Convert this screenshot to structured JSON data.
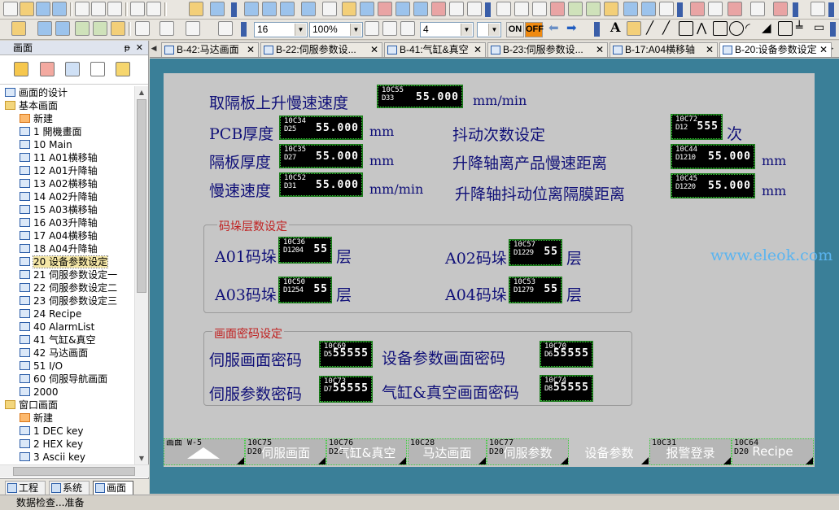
{
  "toolbar": {
    "font_size": "16",
    "zoom": "100%",
    "line_width": "4",
    "on_label": "ON",
    "off_label": "OFF",
    "letter_a": "A"
  },
  "panel": {
    "title": "画面",
    "tree": [
      {
        "label": "画面的设计",
        "kind": "root"
      },
      {
        "label": "基本画面",
        "kind": "folder"
      },
      {
        "label": "新建",
        "kind": "new"
      },
      {
        "label": "1 開機畫面",
        "kind": "page"
      },
      {
        "label": "10 Main",
        "kind": "page"
      },
      {
        "label": "11 A01横移轴",
        "kind": "page"
      },
      {
        "label": "12 A01升降轴",
        "kind": "page"
      },
      {
        "label": "13 A02横移轴",
        "kind": "page"
      },
      {
        "label": "14 A02升降轴",
        "kind": "page"
      },
      {
        "label": "15 A03横移轴",
        "kind": "page"
      },
      {
        "label": "16 A03升降轴",
        "kind": "page"
      },
      {
        "label": "17 A04横移轴",
        "kind": "page"
      },
      {
        "label": "18 A04升降轴",
        "kind": "page"
      },
      {
        "label": "20 设备参数设定",
        "kind": "page",
        "selected": true
      },
      {
        "label": "21 伺服参数设定一",
        "kind": "page"
      },
      {
        "label": "22 伺服参数设定二",
        "kind": "page"
      },
      {
        "label": "23 伺服参数设定三",
        "kind": "page"
      },
      {
        "label": "24 Recipe",
        "kind": "page"
      },
      {
        "label": "40 AlarmList",
        "kind": "page"
      },
      {
        "label": "41 气缸&真空",
        "kind": "page"
      },
      {
        "label": "42 马达画面",
        "kind": "page"
      },
      {
        "label": "51 I/O",
        "kind": "page"
      },
      {
        "label": "60 伺服导航画面",
        "kind": "page"
      },
      {
        "label": "2000",
        "kind": "page"
      },
      {
        "label": "窗口画面",
        "kind": "folder"
      },
      {
        "label": "新建",
        "kind": "new"
      },
      {
        "label": "1 DEC key",
        "kind": "page"
      },
      {
        "label": "2 HEX key",
        "kind": "page"
      },
      {
        "label": "3 Ascii key",
        "kind": "page"
      }
    ],
    "tabs": [
      "工程",
      "系统",
      "画面"
    ]
  },
  "doc_tabs": [
    {
      "label": "B-42:马达画面",
      "active": false
    },
    {
      "label": "B-22:伺服参数设...",
      "active": false
    },
    {
      "label": "B-41:气缸&真空",
      "active": false
    },
    {
      "label": "B-23:伺服参数设...",
      "active": false
    },
    {
      "label": "B-17:A04横移轴",
      "active": false
    },
    {
      "label": "B-20:设备参数设定",
      "active": true
    }
  ],
  "screen": {
    "labels": {
      "slow_up_speed": "取隔板上升慢速速度",
      "pcb_thickness": "PCB厚度",
      "spacer_thickness": "隔板厚度",
      "slow_speed": "慢速速度",
      "shake_count": "抖动次数设定",
      "lift_slow_distance": "升降轴离产品慢速距离",
      "lift_shake_distance": "升降轴抖动位离隔膜距离"
    },
    "units": {
      "mm_min_1": "mm/min",
      "mm_1": "mm",
      "mm_2": "mm",
      "mm_min_2": "mm/min",
      "times": "次",
      "mm_3": "mm",
      "mm_4": "mm"
    },
    "fields": {
      "slow_up_speed": {
        "top": "10C55",
        "bottom": "D33",
        "value": "55.000"
      },
      "pcb_thickness": {
        "top": "10C34",
        "bottom": "D25",
        "value": "55.000"
      },
      "spacer_thickness": {
        "top": "10C35",
        "bottom": "D27",
        "value": "55.000"
      },
      "slow_speed": {
        "top": "10C52",
        "bottom": "D31",
        "value": "55.000"
      },
      "shake_count": {
        "top": "10C72",
        "bottom": "D12",
        "value": "555"
      },
      "lift_slow_distance": {
        "top": "10C44",
        "bottom": "D1210",
        "value": "55.000"
      },
      "lift_shake_distance": {
        "top": "10C45",
        "bottom": "D1220",
        "value": "55.000"
      }
    },
    "stack_group": {
      "title": "码垛层数设定",
      "a01": "A01码垛",
      "a02": "A02码垛",
      "a03": "A03码垛",
      "a04": "A04码垛",
      "unit": "层",
      "f_a01": {
        "top": "10C36",
        "bottom": "D1204",
        "value": "55"
      },
      "f_a02": {
        "top": "10C57",
        "bottom": "D1229",
        "value": "55"
      },
      "f_a03": {
        "top": "10C50",
        "bottom": "D1254",
        "value": "55"
      },
      "f_a04": {
        "top": "10C53",
        "bottom": "D1279",
        "value": "55"
      }
    },
    "password_group": {
      "title": "画面密码设定",
      "servo_screen": "伺服画面密码",
      "device_screen": "设备参数画面密码",
      "servo_param": "伺服参数密码",
      "cyl_screen": "气缸&真空画面密码",
      "f_servo_screen": {
        "top": "10C69",
        "bottom": "D5",
        "value": "55555"
      },
      "f_device_screen": {
        "top": "10C70",
        "bottom": "D6",
        "value": "55555"
      },
      "f_servo_param": {
        "top": "10C73",
        "bottom": "D7",
        "value": "55555"
      },
      "f_cyl_screen": {
        "top": "10C74",
        "bottom": "D8",
        "value": "55555"
      }
    },
    "nav_buttons": [
      {
        "top": "画面 W-5",
        "bottom": "",
        "label": ""
      },
      {
        "top": "10C75",
        "bottom": "D20",
        "label": "伺服画面"
      },
      {
        "top": "10C76",
        "bottom": "D20",
        "label": "气缸&真空"
      },
      {
        "top": "10C28",
        "bottom": "",
        "label": "马达画面"
      },
      {
        "top": "10C77",
        "bottom": "D20",
        "label": "伺服参数"
      },
      {
        "top": "",
        "bottom": "",
        "label": "设备参数",
        "active": true
      },
      {
        "top": "10C31",
        "bottom": "",
        "label": "报警登录"
      },
      {
        "top": "10C64",
        "bottom": "D20",
        "label": "Recipe"
      }
    ]
  },
  "watermark": "www.eleok.com",
  "status": "数据检查...准备"
}
